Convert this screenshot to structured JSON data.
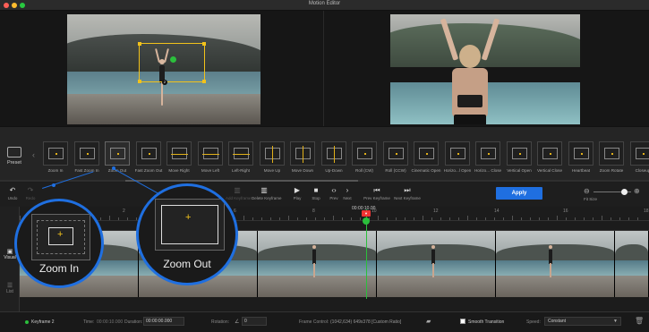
{
  "window": {
    "title": "Motion Editor"
  },
  "presets": {
    "preset_label": "Preset",
    "items": [
      "Zoom In",
      "Fast Zoom In",
      "Zoom Out",
      "Fast Zoom Out",
      "Move Right",
      "Move Left",
      "Left-Right",
      "Move Up",
      "Move Down",
      "Up-Down",
      "Roll (CW)",
      "Roll (CCW)",
      "Cinematic Open",
      "Horizo...l Open",
      "Horizo... Close",
      "Vertical Open",
      "Vertical Close",
      "Heartbeat",
      "Zoom Rotate",
      "Closeup"
    ],
    "active": "Zoom Out"
  },
  "toolbar": {
    "undo": "Undo",
    "redo": "Redo",
    "add_keyframe": "Add Keyframe",
    "delete_keyframe": "Delete Keyframe",
    "play": "Play",
    "stop": "Stop",
    "prev": "Prev",
    "next": "Next",
    "prev_keyframe": "Prev Keyframe",
    "next_keyframe": "Next Keyframe",
    "apply": "Apply",
    "fit_size": "Fit Size"
  },
  "timeline": {
    "current_time": "00:00:10.00",
    "ruler_ticks": [
      "2",
      "4",
      "6",
      "8",
      "10",
      "12",
      "14",
      "16",
      "18"
    ],
    "side_tabs": [
      "Visual",
      "List"
    ]
  },
  "callouts": {
    "zoom_in": "Zoom In",
    "zoom_out": "Zoom Out"
  },
  "bottom": {
    "keyframe": "Keyframe 2",
    "time_label": "Time:",
    "time_value": "00:00:10.000",
    "duration_label": "Duration:",
    "duration_value": "00:00:00.000",
    "rotation_label": "Rotation:",
    "rotation_value": "0",
    "frame_control_label": "Frame Control:",
    "frame_control_value": "(1042,634)  649x378  [Custom Ratio]",
    "smooth_transition": "Smooth Transition",
    "speed_label": "Speed:",
    "speed_value": "Constant"
  },
  "colors": {
    "accent": "#1f6fe0",
    "keyframe_box": "#f2c21b",
    "playhead": "#2bbf3c"
  }
}
